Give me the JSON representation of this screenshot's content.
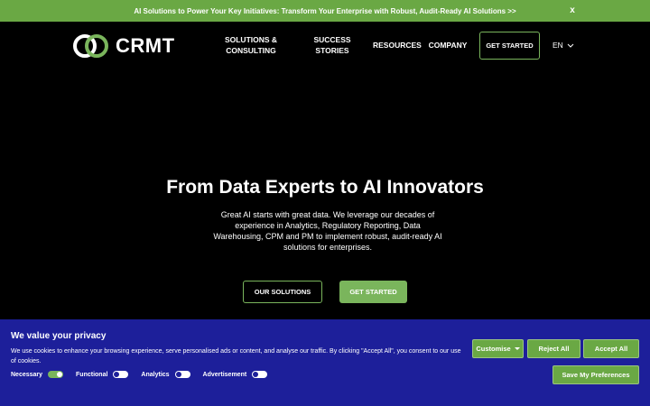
{
  "announcement": {
    "text": "AI Solutions to Power Your Key Initiatives: Transform Your Enterprise with Robust, Audit-Ready AI Solutions >>",
    "close_label": "x"
  },
  "header": {
    "logo_text": "CRMT",
    "nav": [
      {
        "label": "SOLUTIONS & CONSULTING"
      },
      {
        "label": "SUCCESS STORIES"
      },
      {
        "label": "RESOURCES"
      },
      {
        "label": "COMPANY"
      }
    ],
    "cta_label": "GET STARTED",
    "language": "EN"
  },
  "hero": {
    "title": "From Data Experts to AI Innovators",
    "body": "Great AI starts with great data. We leverage our decades of experience in Analytics, Regulatory Reporting, Data Warehousing, CPM and PM to implement robust, audit-ready AI solutions for enterprises.",
    "primary_button": "OUR SOLUTIONS",
    "secondary_button": "GET STARTED"
  },
  "cookie_banner": {
    "title": "We value your privacy",
    "text": "We use cookies to enhance your browsing experience, serve personalised ads or content, and analyse our traffic. By clicking \"Accept All\", you consent to our use of cookies.",
    "toggles": [
      {
        "label": "Necessary",
        "on": true
      },
      {
        "label": "Functional",
        "on": false
      },
      {
        "label": "Analytics",
        "on": false
      },
      {
        "label": "Advertisement",
        "on": false
      }
    ],
    "customise_label": "Customise",
    "reject_label": "Reject All",
    "accept_label": "Accept All",
    "save_label": "Save My Preferences"
  },
  "colors": {
    "accent_green": "#7ab55c",
    "banner_blue": "#1d1f9a",
    "background": "#000000"
  }
}
